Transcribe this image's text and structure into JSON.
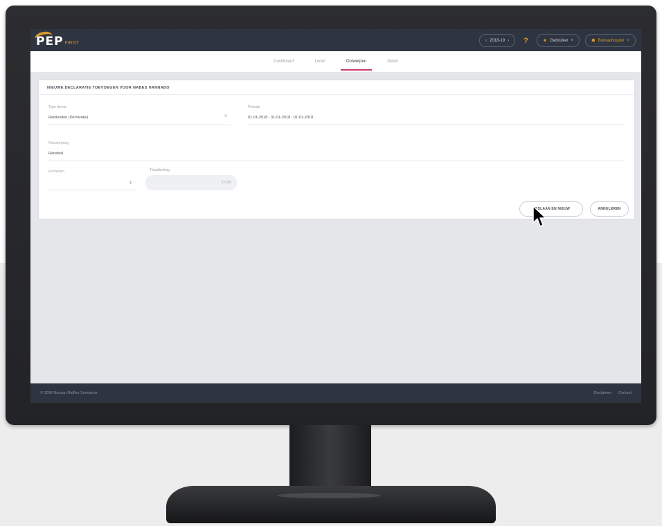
{
  "app": {
    "logo_text": "PEP",
    "logo_sub": "FIRST"
  },
  "topbar": {
    "period_prev": "‹",
    "period_label": "2018-19",
    "period_next": "›",
    "help_label": "?",
    "user_label": "Gebruiker",
    "org_label": "Bureauhouder"
  },
  "tabs": [
    {
      "label": "Dashboard",
      "active": false
    },
    {
      "label": "Leren",
      "active": false
    },
    {
      "label": "Ontwerpen",
      "active": true
    },
    {
      "label": "Delen",
      "active": false
    }
  ],
  "form": {
    "title": "NIEUWE DECLARATIE TOEVOEGEN VOOR NABES HANNABO",
    "type_label": "Type dienst",
    "type_value": "Reiskosten (Declaratie)",
    "period_label": "Periode",
    "period_value": "01-01-2018 - 31-01-2018 - 01-01-2018",
    "desc_label": "Omschrijving",
    "desc_value": "Reisdoel",
    "units_label": "Eenheden",
    "total_label": "Totaalbedrag",
    "total_value": "€ 0,00",
    "btn_save_new": "OPSLAAN EN NIEUW",
    "btn_cancel": "ANNULEREN"
  },
  "footer": {
    "copyright": "© 2018 Nassau Raffles Scenarios",
    "link_privacy": "Disclaimer",
    "link_contact": "Contact"
  },
  "icons": {
    "cursor": "arrow-cursor-icon",
    "user": "user-icon",
    "dropdown": "chevron-down-icon"
  },
  "colors": {
    "topbar": "#2f3540",
    "accent_tab": "#c73d6e",
    "logo_gold": "#d69a2d"
  }
}
